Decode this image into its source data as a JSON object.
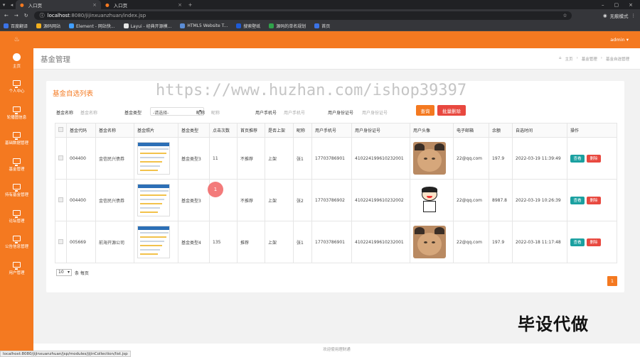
{
  "browser": {
    "tabs": [
      {
        "label": "入口页",
        "active": true
      },
      {
        "label": "入口页",
        "active": false
      }
    ],
    "url_host": "localhost",
    "url_rest": ":8080/jijinxuanzhuan/index.jsp",
    "incognito_label": "无痕模式",
    "bookmarks": [
      "百度翻译",
      "源码网站",
      "Element - 网站快...",
      "Layui - 经典开源模...",
      "HTML5 Website T...",
      "搜索壁纸",
      "源码的单名规划",
      "首页"
    ]
  },
  "sidebar": {
    "items": [
      {
        "label": "主页",
        "icon": "dashboard-icon"
      },
      {
        "label": "个人中心",
        "icon": "monitor-icon"
      },
      {
        "label": "轮播图信息",
        "icon": "monitor-icon"
      },
      {
        "label": "基础数据管理",
        "icon": "monitor-icon"
      },
      {
        "label": "基金管理",
        "icon": "monitor-icon"
      },
      {
        "label": "持有基金管理",
        "icon": "monitor-icon"
      },
      {
        "label": "论坛管理",
        "icon": "monitor-icon"
      },
      {
        "label": "公告信息管理",
        "icon": "monitor-icon"
      },
      {
        "label": "用户管理",
        "icon": "monitor-icon"
      }
    ]
  },
  "topbar": {
    "admin_label": "admin ▾"
  },
  "pagehead": {
    "title": "基金管理",
    "crumbs": [
      "主页",
      "基金管理",
      "基金自选管理"
    ]
  },
  "card": {
    "title": "基金自选列表"
  },
  "filters": {
    "fund_name_label": "基金名称",
    "fund_name_placeholder": "基金名称",
    "fund_type_label": "基金类型",
    "fund_type_value": "-请选择-",
    "nick_label": "昵称",
    "nick_placeholder": "昵称",
    "phone_label": "用户手机号",
    "phone_placeholder": "用户手机号",
    "id_label": "用户身份证号",
    "id_placeholder": "用户身份证号",
    "search_btn": "查询",
    "batch_delete_btn": "批量删除"
  },
  "table": {
    "headers": [
      "基金代码",
      "基金名称",
      "基金照片",
      "基金类型",
      "点击次数",
      "首页推荐",
      "是否上架",
      "昵称",
      "用户手机号",
      "用户身份证号",
      "用户头像",
      "电子邮箱",
      "余额",
      "自选时间",
      "操作"
    ],
    "rows": [
      {
        "code": "004400",
        "name": "金信民兴债券",
        "type": "基金类型3",
        "clicks": "11",
        "recommend": "不推荐",
        "listed": "上架",
        "nick": "张1",
        "phone": "17703786901",
        "idno": "410224199610232001",
        "avatar": "cat",
        "email": "22@qq.com",
        "balance": "197.9",
        "time": "2022-03-19 11:39:49"
      },
      {
        "code": "004400",
        "name": "金信民兴债券",
        "type": "基金类型3",
        "clicks": "",
        "recommend": "不推荐",
        "listed": "上架",
        "nick": "张2",
        "phone": "17703786902",
        "idno": "410224199610232002",
        "avatar": "cartoon",
        "email": "22@qq.com",
        "balance": "8987.8",
        "time": "2022-03-19 10:26:39"
      },
      {
        "code": "005669",
        "name": "前海开源公司",
        "type": "基金类型4",
        "clicks": "135",
        "recommend": "推荐",
        "listed": "上架",
        "nick": "张1",
        "phone": "17703786901",
        "idno": "410224199610232001",
        "avatar": "cat",
        "email": "22@qq.com",
        "balance": "197.9",
        "time": "2022-03-18 11:17:48"
      }
    ],
    "view_label": "查看",
    "delete_label": "删除"
  },
  "pager": {
    "page_size": "10",
    "per_page_label": "条 每页",
    "current_page": "1"
  },
  "watermark": "https://www.huzhan.com/ishop39397",
  "click_marker": "1",
  "corner_text": "毕设代做",
  "footer": "欢迎使用理财通",
  "status_url": "localhost:8080/jijinxuanzhuan/jsp/modules/jijinCollection/list.jsp"
}
